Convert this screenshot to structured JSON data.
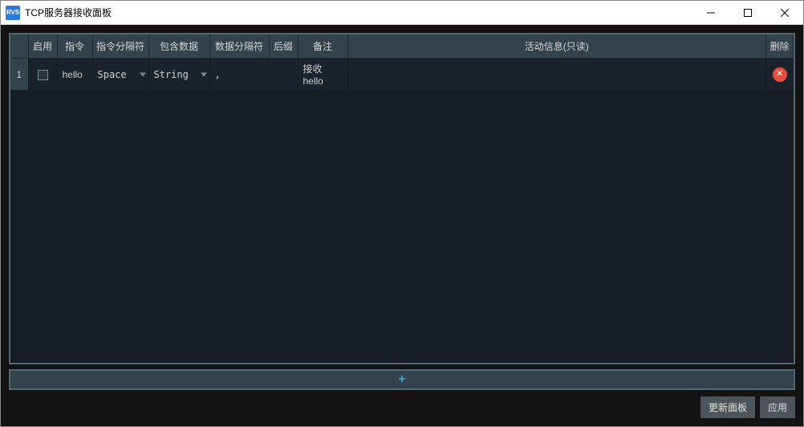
{
  "window": {
    "app_icon_text": "RVS",
    "title": "TCP服务器接收面板"
  },
  "table": {
    "headers": {
      "rowidx": "",
      "enable": "启用",
      "cmd": "指令",
      "cmdsep": "指令分隔符",
      "datatype": "包含数据",
      "datasep": "数据分隔符",
      "suffix": "后缀",
      "remark": "备注",
      "activity": "活动信息(只读)",
      "delete": "删除"
    },
    "rows": [
      {
        "index": "1",
        "enabled": false,
        "cmd": "hello",
        "cmdsep": "Space",
        "datatype": "String",
        "datasep": ",",
        "suffix": "",
        "remark": "接收hello",
        "activity": ""
      }
    ]
  },
  "footer": {
    "update_label": "更新面板",
    "apply_label": "应用"
  }
}
